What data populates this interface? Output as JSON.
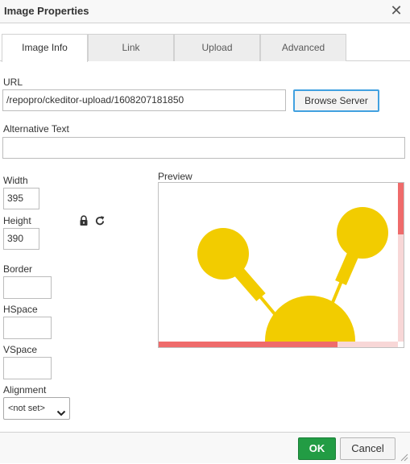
{
  "dialog": {
    "title": "Image Properties",
    "close_icon": "close-icon"
  },
  "tabs": [
    {
      "label": "Image Info",
      "active": true
    },
    {
      "label": "Link",
      "active": false
    },
    {
      "label": "Upload",
      "active": false
    },
    {
      "label": "Advanced",
      "active": false
    }
  ],
  "url": {
    "label": "URL",
    "value": "/repopro/ckeditor-upload/1608207181850",
    "browse_label": "Browse Server"
  },
  "alt_text": {
    "label": "Alternative Text",
    "value": ""
  },
  "dimensions": {
    "width_label": "Width",
    "width_value": "395",
    "height_label": "Height",
    "height_value": "390",
    "lock_icon": "lock-icon",
    "reset_icon": "reset-size-icon"
  },
  "border": {
    "label": "Border",
    "value": ""
  },
  "hspace": {
    "label": "HSpace",
    "value": ""
  },
  "vspace": {
    "label": "VSpace",
    "value": ""
  },
  "alignment": {
    "label": "Alignment",
    "selected": "<not set>"
  },
  "preview": {
    "label": "Preview"
  },
  "footer": {
    "ok_label": "OK",
    "cancel_label": "Cancel"
  },
  "colors": {
    "accent_focus": "#42a1e0",
    "ok_green": "#229c44",
    "preview_yellow": "#f2cc00",
    "scrollbar_red": "#ef6b6b"
  }
}
